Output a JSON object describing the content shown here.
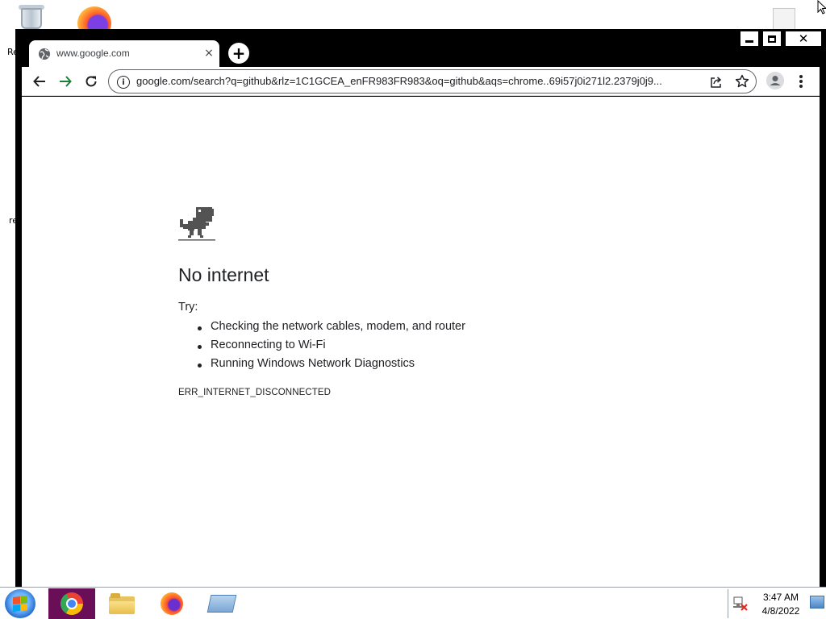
{
  "desktop": {
    "icons": [
      {
        "name": "recycle-bin",
        "label": "Re"
      },
      {
        "name": "firefox"
      },
      {
        "name": "document"
      }
    ],
    "partial_label_2": "re"
  },
  "browser": {
    "tab": {
      "title": "www.google.com",
      "close": "×"
    },
    "new_tab": "+",
    "window_controls": {
      "close": "✕"
    },
    "address": "google.com/search?q=github&rlz=1C1GCEA_enFR983FR983&oq=github&aqs=chrome..69i57j0i271l2.2379j0j9...",
    "info_icon": "i"
  },
  "page": {
    "title": "No internet",
    "try_label": "Try:",
    "suggestions": [
      "Checking the network cables, modem, and router",
      "Reconnecting to Wi-Fi",
      "Running Windows Network Diagnostics"
    ],
    "error_code": "ERR_INTERNET_DISCONNECTED"
  },
  "taskbar": {
    "items": [
      "chrome",
      "file-explorer",
      "firefox",
      "computer"
    ],
    "active_item_color": "#6a0f57",
    "time": "3:47 AM",
    "date": "4/8/2022"
  },
  "colors": {
    "forward_arrow": "#188038",
    "text": "#202124"
  }
}
